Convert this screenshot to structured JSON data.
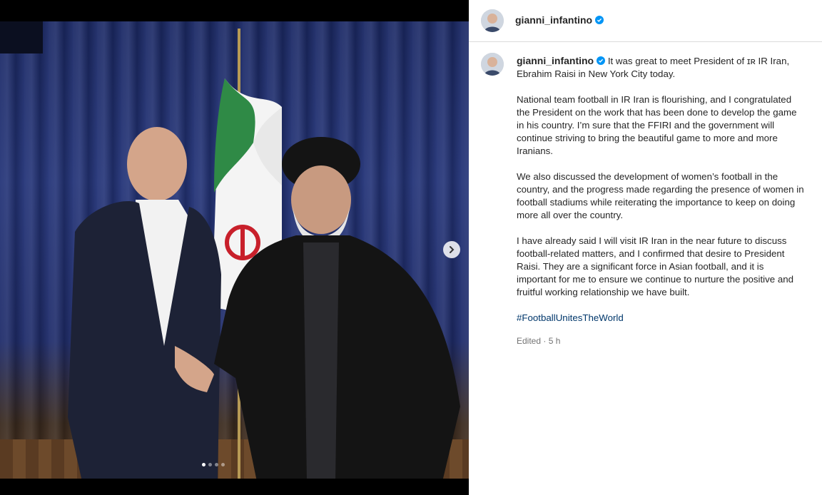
{
  "post": {
    "username": "gianni_infantino",
    "caption_intro": "It was great to meet President of ɪʀ IR Iran, Ebrahim Raisi in New York City today.",
    "paragraphs": [
      "National team football in IR Iran is flourishing, and I congratulated the President on the work that has been done to develop the game in his country. I’m sure that the FFIRI and the government will continue striving to bring the beautiful game to more and more Iranians.",
      "We also discussed the development of women’s football in the country, and the progress made regarding the presence of women in football stadiums while reiterating the importance to keep on doing more all over the country.",
      "I have already said I will visit IR Iran in the near future to discuss football-related matters, and I confirmed that desire to President Raisi. They are a significant force in Asian football, and it is important for me to ensure we continue to nurture the positive and fruitful working relationship we have built."
    ],
    "hashtag": "#FootballUnitesTheWorld",
    "meta": "Edited · 5 h"
  },
  "carousel": {
    "slide_count": 4,
    "active_index": 0,
    "next_icon": "chevron-right-icon"
  },
  "colors": {
    "verified": "#0095f6",
    "hashtag": "#00376b",
    "divider": "#dbdbdb"
  }
}
